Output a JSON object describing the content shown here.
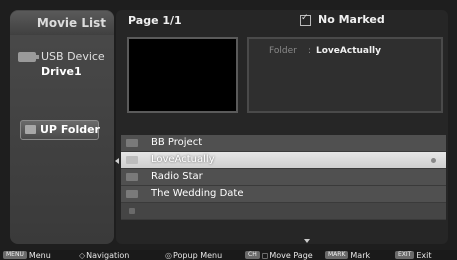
{
  "sidebar": {
    "title": "Movie List",
    "device_label": "USB Device",
    "drive_name": "Drive1",
    "up_folder_label": "UP Folder"
  },
  "header": {
    "page_indicator": "Page 1/1",
    "mark_status": "No Marked"
  },
  "info": {
    "key": "Folder",
    "separator": ":",
    "value": "LoveActually"
  },
  "files": [
    {
      "name": "BB Project",
      "selected": false
    },
    {
      "name": "LoveActually",
      "selected": true
    },
    {
      "name": "Radio Star",
      "selected": false
    },
    {
      "name": "The Wedding Date",
      "selected": false
    },
    {
      "name": "",
      "selected": false
    }
  ],
  "footer": {
    "menu": {
      "key": "MENU",
      "label": "Menu"
    },
    "navigation": {
      "glyph": "◇",
      "label": "Navigation"
    },
    "popup": {
      "glyph": "◎",
      "label": "Popup Menu"
    },
    "move": {
      "key": "CH",
      "glyph": "◻",
      "label": "Move Page"
    },
    "mark": {
      "key": "MARK",
      "label": "Mark"
    },
    "exit": {
      "key": "EXIT",
      "label": "Exit"
    }
  },
  "colors": {
    "background": "#1e1e1e",
    "selected_row": "#dcdcdc",
    "row": "#505050"
  }
}
